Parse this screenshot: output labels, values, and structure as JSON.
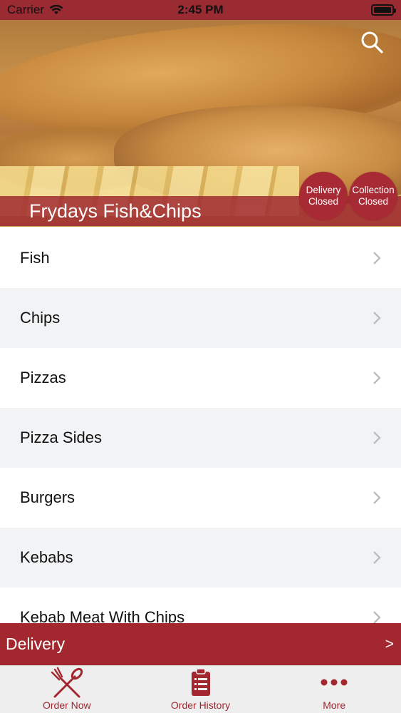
{
  "status_bar": {
    "carrier": "Carrier",
    "time": "2:45 PM"
  },
  "header": {
    "shop_name": "Frydays Fish&Chips",
    "delivery_status": {
      "line1": "Delivery",
      "line2": "Closed"
    },
    "collection_status": {
      "line1": "Collection",
      "line2": "Closed"
    }
  },
  "menu": {
    "items": [
      {
        "label": "Fish"
      },
      {
        "label": "Chips"
      },
      {
        "label": "Pizzas"
      },
      {
        "label": "Pizza Sides"
      },
      {
        "label": "Burgers"
      },
      {
        "label": "Kebabs"
      },
      {
        "label": "Kebab Meat With Chips"
      }
    ]
  },
  "order_mode": {
    "label": "Delivery",
    "arrow": ">"
  },
  "tabs": [
    {
      "label": "Order Now",
      "icon": "fork-spoon-icon"
    },
    {
      "label": "Order History",
      "icon": "clipboard-list-icon"
    },
    {
      "label": "More",
      "icon": "more-dots-icon"
    }
  ],
  "colors": {
    "brand": "#a3272f",
    "row_alt": "#f2f3f5",
    "tab_bg": "#eeeeee"
  }
}
